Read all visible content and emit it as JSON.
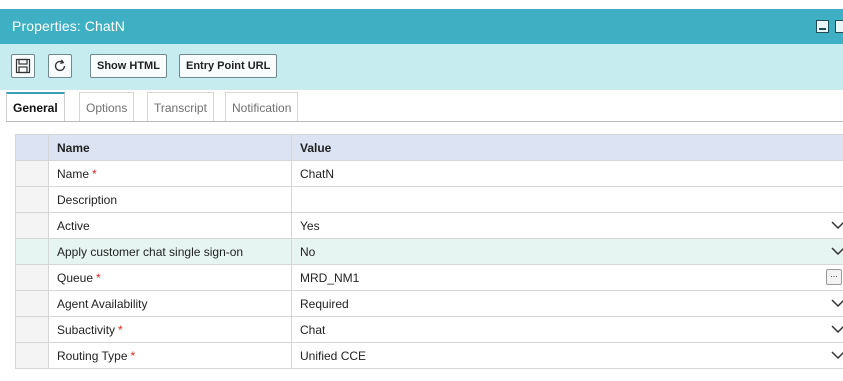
{
  "window": {
    "title": "Properties: ChatN"
  },
  "toolbar": {
    "save_icon": "save-icon",
    "refresh_icon": "refresh-icon",
    "show_html_label": "Show HTML",
    "entry_point_url_label": "Entry Point URL"
  },
  "tabs": [
    {
      "label": "General",
      "active": true
    },
    {
      "label": "Options",
      "active": false
    },
    {
      "label": "Transcript",
      "active": false
    },
    {
      "label": "Notification",
      "active": false
    }
  ],
  "grid": {
    "headers": {
      "name": "Name",
      "value": "Value"
    },
    "rows": [
      {
        "name": "Name",
        "required": "*",
        "value": "ChatN",
        "control": "none"
      },
      {
        "name": "Description",
        "required": "",
        "value": "",
        "control": "none"
      },
      {
        "name": "Active",
        "required": "",
        "value": "Yes",
        "control": "dropdown"
      },
      {
        "name": "Apply customer chat single sign-on",
        "required": "",
        "value": "No",
        "control": "dropdown",
        "selected": true
      },
      {
        "name": "Queue",
        "required": "*",
        "value": "MRD_NM1",
        "control": "ellipsis",
        "ellipsis_label": "..."
      },
      {
        "name": "Agent Availability",
        "required": "",
        "value": "Required",
        "control": "dropdown"
      },
      {
        "name": "Subactivity",
        "required": "*",
        "value": "Chat",
        "control": "dropdown"
      },
      {
        "name": "Routing Type",
        "required": "*",
        "value": "Unified CCE",
        "control": "dropdown"
      }
    ]
  },
  "colors": {
    "titlebar": "#3fb0c4",
    "toolbar": "#c7ecef",
    "header_row": "#dce4f3",
    "selected_row": "#e6f5f1",
    "required_marker": "#d9261c",
    "active_tab_accent": "#3a9fb5"
  }
}
